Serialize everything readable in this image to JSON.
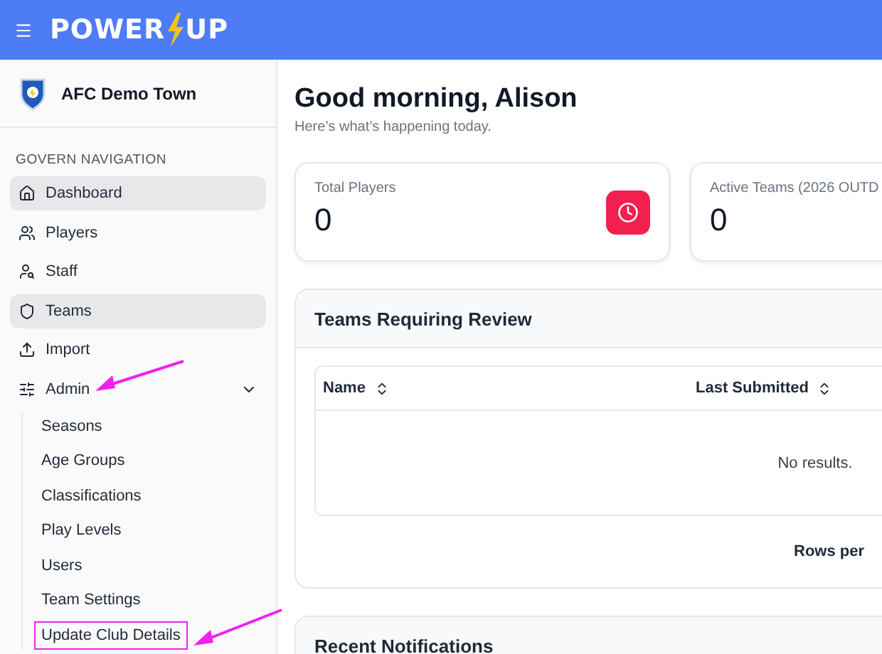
{
  "header": {
    "logo_left": "POWER",
    "logo_right": "UP"
  },
  "club": {
    "name": "AFC Demo Town"
  },
  "sidebar": {
    "section_title": "GOVERN NAVIGATION",
    "items": [
      {
        "label": "Dashboard",
        "selected": true
      },
      {
        "label": "Players",
        "selected": false
      },
      {
        "label": "Staff",
        "selected": false
      },
      {
        "label": "Teams",
        "selected": true
      },
      {
        "label": "Import",
        "selected": false
      },
      {
        "label": "Admin",
        "selected": false,
        "expanded": true,
        "arrow": true,
        "children": [
          {
            "label": "Seasons",
            "boxed": false,
            "arrow": false
          },
          {
            "label": "Age Groups",
            "boxed": false,
            "arrow": false
          },
          {
            "label": "Classifications",
            "boxed": false,
            "arrow": false
          },
          {
            "label": "Play Levels",
            "boxed": false,
            "arrow": false
          },
          {
            "label": "Users",
            "boxed": false,
            "arrow": false
          },
          {
            "label": "Team Settings",
            "boxed": false,
            "arrow": false
          },
          {
            "label": "Update Club Details",
            "boxed": true,
            "arrow": true
          }
        ]
      }
    ]
  },
  "greeting": {
    "title": "Good morning, Alison",
    "subtitle": "Here’s what’s happening today."
  },
  "stats": [
    {
      "label": "Total Players",
      "value": "0"
    },
    {
      "label": "Active Teams (2026 OUTD",
      "value": "0"
    }
  ],
  "review": {
    "title": "Teams Requiring Review",
    "columns": [
      "Name",
      "Last Submitted"
    ],
    "empty": "No results.",
    "footer": "Rows per"
  },
  "notifications": {
    "title": "Recent Notifications"
  }
}
